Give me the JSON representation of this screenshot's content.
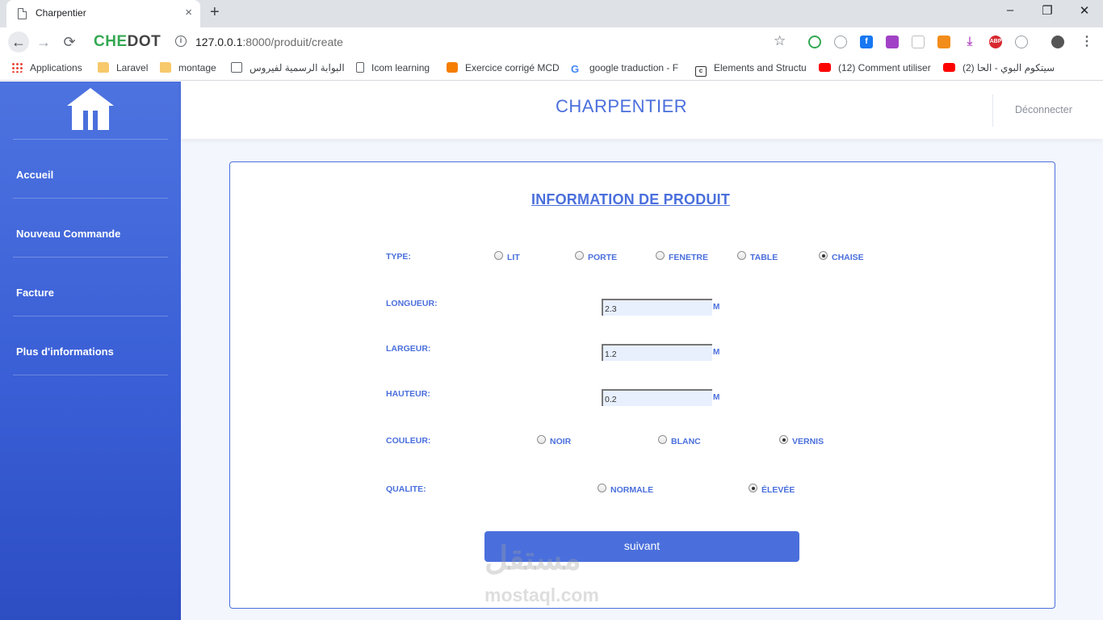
{
  "browser": {
    "tab_title": "Charpentier",
    "tab_close": "×",
    "new_tab": "+",
    "window": {
      "minimize": "–",
      "restore": "❐",
      "close": "✕"
    },
    "nav": {
      "back": "←",
      "forward": "→",
      "reload": "⟳"
    },
    "browser_logo": {
      "part1": "CHE",
      "part2": "DOT"
    },
    "url_host": "127.0.0.1",
    "url_path": ":8000/produit/create",
    "bookmark_star": "☆",
    "extensions_icon_names": [
      "puzzle-icon",
      "whatsapp-icon",
      "facebook-icon",
      "tv-icon",
      "lock-icon",
      "video-icon",
      "download-icon",
      "abp-icon",
      "messenger-icon",
      "avatar-icon"
    ],
    "abp_text": "ABP",
    "bookmarks": [
      {
        "label": "Applications",
        "icon": "grid"
      },
      {
        "label": "Laravel",
        "icon": "folder"
      },
      {
        "label": "montage",
        "icon": "folder"
      },
      {
        "label": "البوابة الرسمية لفيروس",
        "icon": "envelope"
      },
      {
        "label": "Icom learning",
        "icon": "page"
      },
      {
        "label": "Exercice corrigé MCD",
        "icon": "blogger"
      },
      {
        "label": "google traduction - F",
        "icon": "google"
      },
      {
        "label": "Elements and Structu",
        "icon": "csharp"
      },
      {
        "label": "(12) Comment utiliser",
        "icon": "yt"
      },
      {
        "label": "(2) سيتكوم البوي - الحا",
        "icon": "yt"
      }
    ]
  },
  "app": {
    "brand": "CHARPENTIER",
    "logout_label": "Déconnecter",
    "sidebar": {
      "items": [
        {
          "label": "Accueil"
        },
        {
          "label": "Nouveau Commande"
        },
        {
          "label": "Facture"
        },
        {
          "label": "Plus d'informations"
        }
      ]
    },
    "form": {
      "title": "INFORMATION DE PRODUIT",
      "type_label": "TYPE:",
      "type_options": [
        "LIT",
        "PORTE",
        "FENETRE",
        "TABLE",
        "CHAISE"
      ],
      "type_selected": "CHAISE",
      "longueur_label": "LONGUEUR:",
      "longueur_value": "2.3",
      "largeur_label": "LARGEUR:",
      "largeur_value": "1.2",
      "hauteur_label": "HAUTEUR:",
      "hauteur_value": "0.2",
      "unit": "M",
      "couleur_label": "COULEUR:",
      "couleur_options": [
        "NOIR",
        "BLANC",
        "VERNIS"
      ],
      "couleur_selected": "VERNIS",
      "qualite_label": "QUALITE:",
      "qualite_options": [
        "NORMALE",
        "ÉLEVÉE"
      ],
      "qualite_selected": "ÉLEVÉE",
      "submit_label": "suivant"
    }
  },
  "watermark": {
    "arabic": "مستقل",
    "latin": "mostaql.com"
  }
}
